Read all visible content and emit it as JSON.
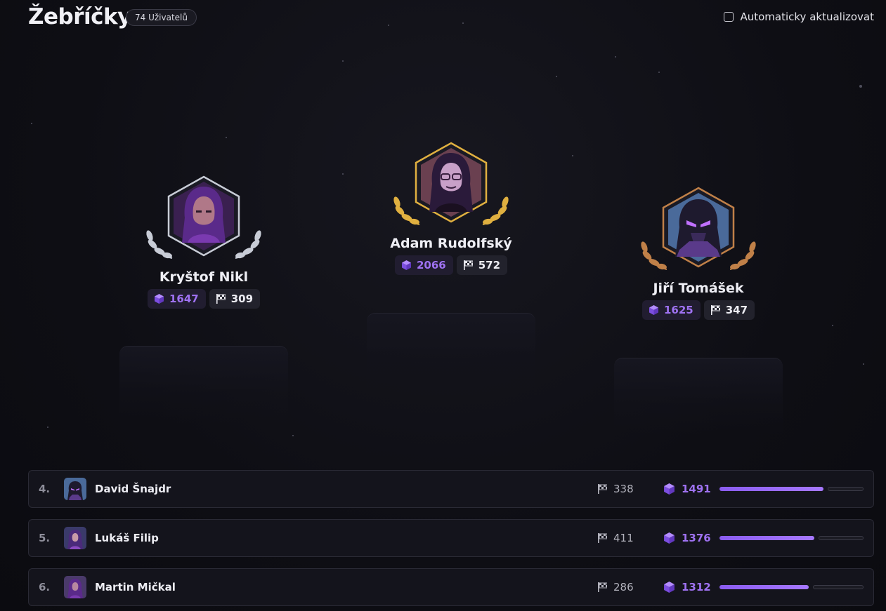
{
  "header": {
    "title": "Žebříčky",
    "user_count": "74 Uživatelů",
    "auto_refresh_label": "Automaticky aktualizovat",
    "auto_refresh_checked": false
  },
  "podium": [
    {
      "place": 2,
      "name": "Kryštof Nikl",
      "score": "1647",
      "flags": "309",
      "frame": "silver",
      "avatar_icon": "hooded-avatar-icon"
    },
    {
      "place": 1,
      "name": "Adam Rudolfský",
      "score": "2066",
      "flags": "572",
      "frame": "gold",
      "avatar_icon": "hooded-glasses-avatar-icon"
    },
    {
      "place": 3,
      "name": "Jiří Tomášek",
      "score": "1625",
      "flags": "347",
      "frame": "bronze",
      "avatar_icon": "robot-avatar-icon"
    }
  ],
  "ranking": [
    {
      "rank": "4.",
      "name": "David Šnajdr",
      "flags": "338",
      "score": "1491",
      "progress": 0.72
    },
    {
      "rank": "5.",
      "name": "Lukáš Filip",
      "flags": "411",
      "score": "1376",
      "progress": 0.66
    },
    {
      "rank": "6.",
      "name": "Martin Mičkal",
      "flags": "286",
      "score": "1312",
      "progress": 0.62
    }
  ],
  "colors": {
    "accent": "#9f72f2",
    "gold": "#e0b040",
    "silver": "#c8ccd6",
    "bronze": "#c08048",
    "background": "#0e0e14"
  }
}
